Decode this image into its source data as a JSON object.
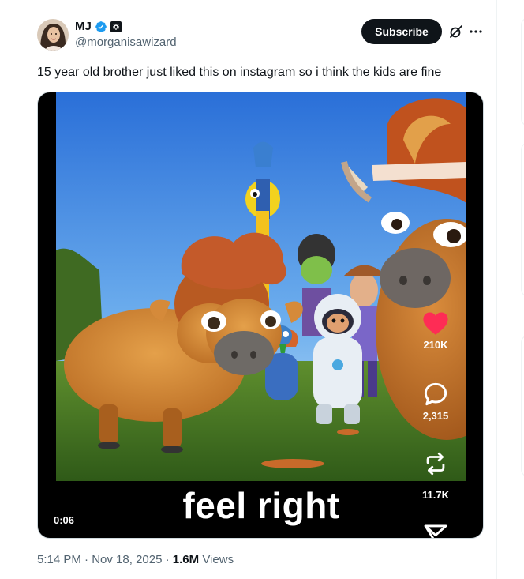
{
  "author": {
    "display_name": "MJ",
    "handle": "@morganisawizard"
  },
  "header": {
    "subscribe_label": "Subscribe"
  },
  "tweet": {
    "text": "15 year old brother just liked this on instagram so i think the kids are fine"
  },
  "video": {
    "caption": "feel right",
    "elapsed": "0:06",
    "likes": "210K",
    "comments": "2,315",
    "reposts": "11.7K"
  },
  "meta": {
    "time": "5:14 PM",
    "date": "Nov 18, 2025",
    "views_count": "1.6M",
    "views_label": "Views",
    "separator": "·"
  },
  "icons": {
    "verified": "verified-badge-icon",
    "affiliate": "affiliate-badge-icon",
    "grok": "grok-icon",
    "more": "more-icon",
    "like": "heart-icon",
    "comment": "comment-icon",
    "repost": "repost-icon",
    "share": "share-icon"
  },
  "colors": {
    "text": "#0f1419",
    "secondary": "#536471",
    "verified": "#1d9bf0",
    "heart": "#fe2c55",
    "button": "#0f1419"
  }
}
